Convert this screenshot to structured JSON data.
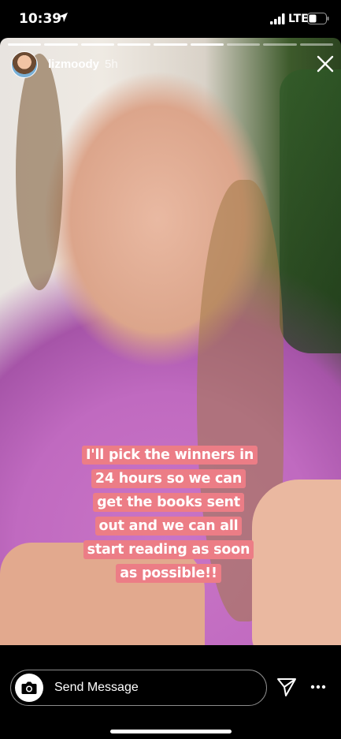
{
  "status_bar": {
    "time": "10:39",
    "network": "LTE",
    "icons": [
      "location-arrow-icon",
      "signal-bars-icon",
      "battery-icon"
    ]
  },
  "story": {
    "username": "lizmoody",
    "time_ago": "5h",
    "progress": {
      "total_segments": 9,
      "current_segment": 6
    },
    "caption": "I'll pick the winners in 24 hours so we can get the books sent out and we can all start reading as soon as possible!!",
    "caption_color": "#ec7d86"
  },
  "bottom_bar": {
    "message_label": "Send Message",
    "icons": [
      "camera-icon",
      "send-paper-plane-icon",
      "more-options-icon"
    ]
  }
}
